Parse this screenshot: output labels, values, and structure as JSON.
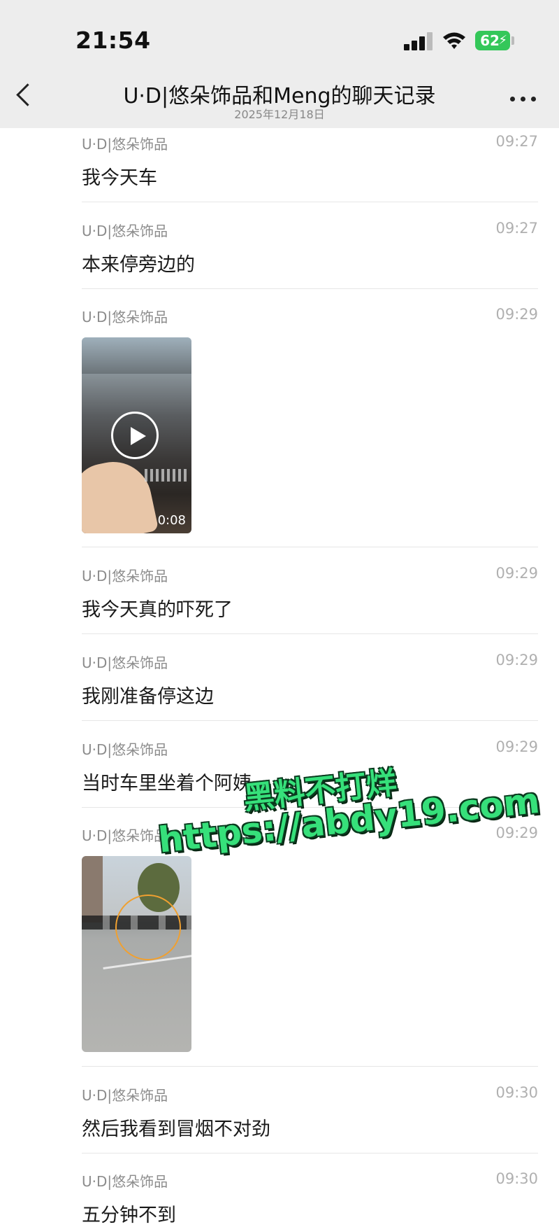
{
  "status": {
    "time": "21:54",
    "battery": "62"
  },
  "nav": {
    "title": "U·D|悠朵饰品和Meng的聊天记录",
    "date": "2025年12月18日"
  },
  "messages": [
    {
      "sender": "U·D|悠朵饰品",
      "time": "09:27",
      "text": "我今天车"
    },
    {
      "sender": "U·D|悠朵饰品",
      "time": "09:27",
      "text": "本来停旁边的"
    },
    {
      "sender": "U·D|悠朵饰品",
      "time": "09:29",
      "video_duration": "0:08"
    },
    {
      "sender": "U·D|悠朵饰品",
      "time": "09:29",
      "text": "我今天真的吓死了"
    },
    {
      "sender": "U·D|悠朵饰品",
      "time": "09:29",
      "text": "我刚准备停这边"
    },
    {
      "sender": "U·D|悠朵饰品",
      "time": "09:29",
      "text": "当时车里坐着个阿姨"
    },
    {
      "sender": "U·D|悠朵饰品",
      "time": "09:29"
    },
    {
      "sender": "U·D|悠朵饰品",
      "time": "09:30",
      "text": "然后我看到冒烟不对劲"
    },
    {
      "sender": "U·D|悠朵饰品",
      "time": "09:30",
      "text": "五分钟不到"
    }
  ],
  "watermark": {
    "line1": "黑料不打烊",
    "line2": "https://abdy19.com"
  },
  "colors": {
    "header_bg": "#ededed",
    "watermark": "#36e07a",
    "battery": "#34c759"
  }
}
